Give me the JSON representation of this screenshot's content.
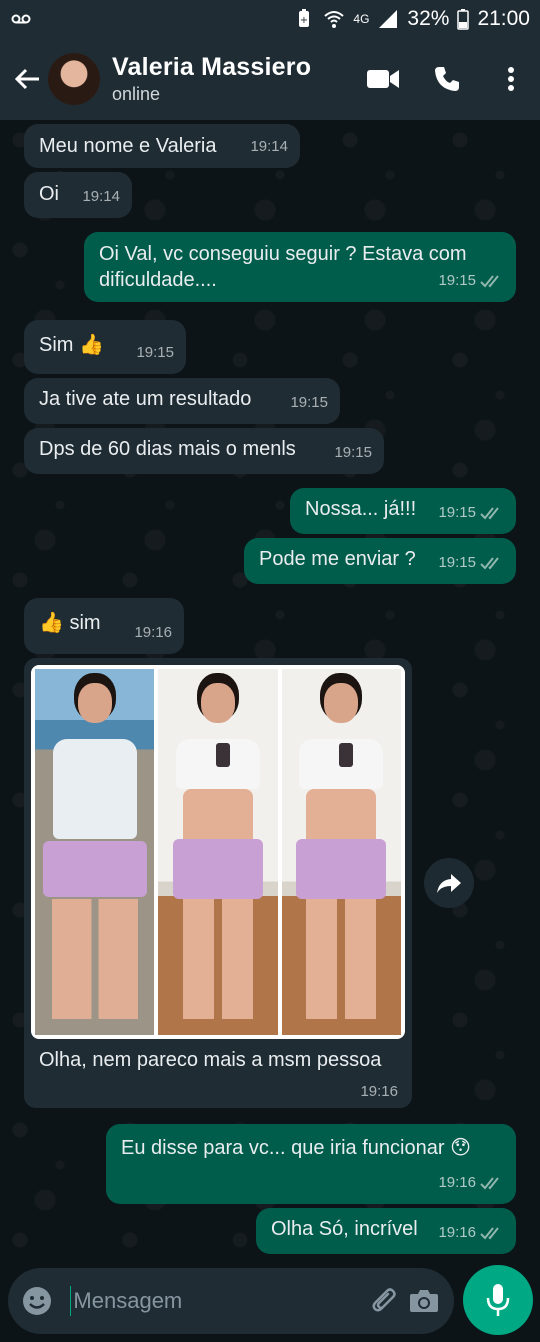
{
  "statusbar": {
    "battery": "32%",
    "time": "21:00",
    "network": "4G",
    "icons": [
      "voicemail-icon",
      "battery-saver-icon",
      "wifi-icon",
      "signal-icon",
      "battery-icon"
    ]
  },
  "header": {
    "contact_name": "Valeria Massiero",
    "contact_status": "online",
    "icons": [
      "back-arrow-icon",
      "video-call-icon",
      "phone-icon",
      "more-vert-icon"
    ]
  },
  "messages": [
    {
      "dir": "in",
      "text": "Meu nome e Valeria",
      "time": "19:14"
    },
    {
      "dir": "in",
      "text": "Oi",
      "time": "19:14"
    },
    {
      "dir": "out",
      "text": "Oi Val, vc conseguiu seguir ? Estava com dificuldade....",
      "time": "19:15"
    },
    {
      "dir": "in",
      "text": "Sim 👍",
      "time": "19:15"
    },
    {
      "dir": "in",
      "text": "Ja tive ate um resultado",
      "time": "19:15"
    },
    {
      "dir": "in",
      "text": "Dps de 60 dias mais o menls",
      "time": "19:15"
    },
    {
      "dir": "out",
      "text": "Nossa... já!!!",
      "time": "19:15"
    },
    {
      "dir": "out",
      "text": "Pode me enviar ?",
      "time": "19:15"
    },
    {
      "dir": "in",
      "text": "👍 sim",
      "time": "19:16"
    },
    {
      "dir": "in",
      "type": "image",
      "caption": "Olha, nem pareco mais a msm pessoa",
      "time": "19:16"
    },
    {
      "dir": "out",
      "text": "Eu disse para vc... que iria funcionar 😯",
      "time": "19:16"
    },
    {
      "dir": "out",
      "text": "Olha Só, incrível",
      "time": "19:16"
    }
  ],
  "colors": {
    "incoming_bubble": "#1f2c34",
    "outgoing_bubble": "#005c4b",
    "accent": "#00a884",
    "header": "#1f2c34",
    "read_ticks": "#8fb7ad"
  },
  "composer": {
    "placeholder": "Mensagem",
    "icons": [
      "emoji-icon",
      "attach-icon",
      "camera-icon",
      "mic-icon"
    ]
  }
}
